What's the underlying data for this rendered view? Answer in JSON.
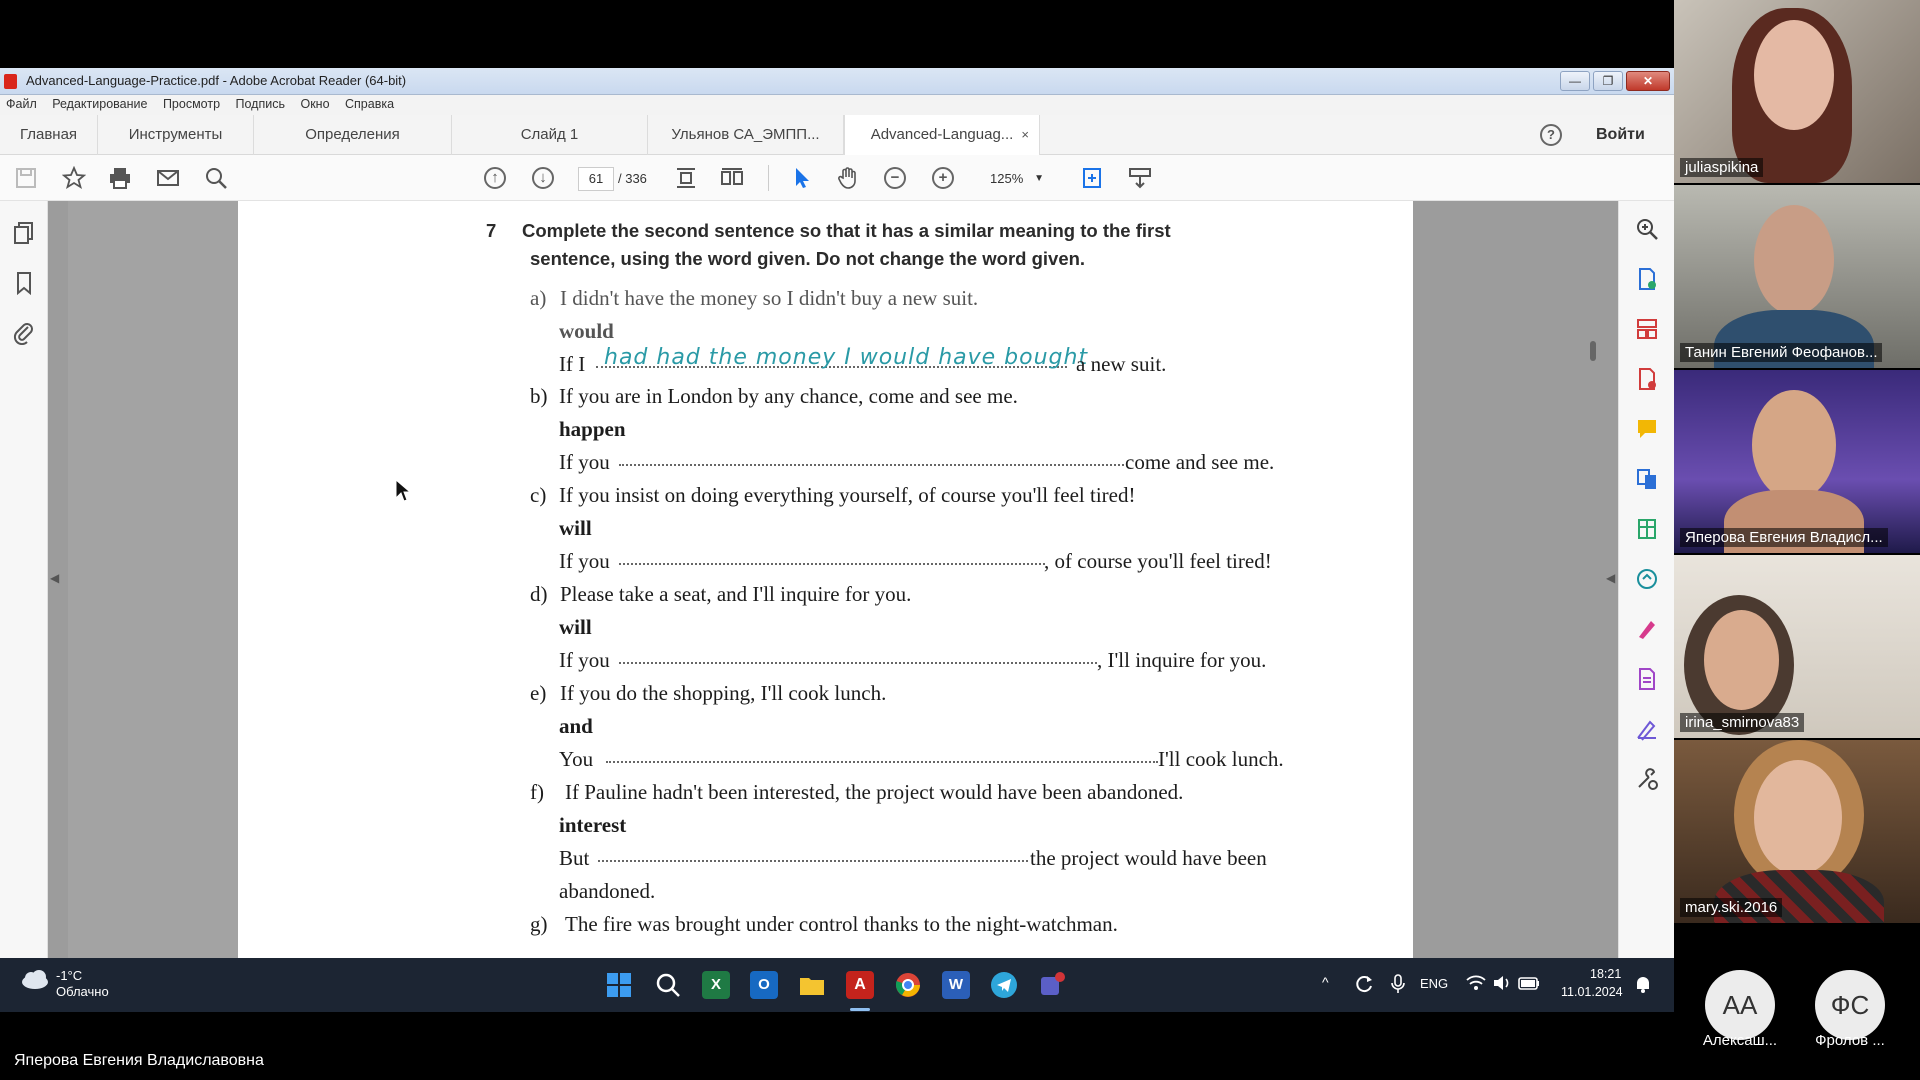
{
  "window": {
    "title": "Advanced-Language-Practice.pdf - Adobe Acrobat Reader (64-bit)",
    "minimize": "—",
    "restore": "❐",
    "close": "✕"
  },
  "menu": [
    "Файл",
    "Редактирование",
    "Просмотр",
    "Подпись",
    "Окно",
    "Справка"
  ],
  "tabs": {
    "home": "Главная",
    "tools": "Инструменты",
    "doc1": "Определения",
    "doc2": "Слайд 1",
    "doc3": "Ульянов СА_ЭМПП...",
    "doc4": "Advanced-Languag...",
    "close_icon": "×",
    "help": "?",
    "signin": "Войти"
  },
  "toolbar": {
    "page_current": "61",
    "page_total": "/ 336",
    "zoom": "125%"
  },
  "document": {
    "exercise_number": "7",
    "instruction_line1": "Complete the second sentence so that it has a similar meaning to the first",
    "instruction_line2": "sentence, using the word given. Do not change the word given.",
    "items": {
      "a": {
        "label": "a)",
        "sentence": "I didn't have the money so I didn't buy a new suit.",
        "word": "would",
        "start": "If I",
        "end": "a new suit.",
        "handwritten": "had had the money I would have bought"
      },
      "b": {
        "label": "b)",
        "sentence": "If you are in London by any chance, come and see me.",
        "word": "happen",
        "start": "If you",
        "end": "come and see me."
      },
      "c": {
        "label": "c)",
        "sentence": "If you insist on doing everything yourself, of course you'll feel tired!",
        "word": "will",
        "start": "If you",
        "end": ", of course you'll feel tired!"
      },
      "d": {
        "label": "d)",
        "sentence": "Please take a seat, and I'll inquire for you.",
        "word": "will",
        "start": "If you",
        "end": ", I'll inquire for you."
      },
      "e": {
        "label": "e)",
        "sentence": "If you do the shopping, I'll cook lunch.",
        "word": "and",
        "start": "You",
        "end": "I'll cook lunch."
      },
      "f": {
        "label": "f)",
        "sentence": "If Pauline hadn't been interested, the project would have been abandoned.",
        "word": "interest",
        "start": "But",
        "end": "the project would have been",
        "end2": "abandoned."
      },
      "g": {
        "label": "g)",
        "sentence": "The fire was brought under control thanks to the night-watchman."
      }
    }
  },
  "taskbar": {
    "weather_temp": "-1°C",
    "weather_desc": "Облачно",
    "lang": "ENG",
    "time": "18:21",
    "date": "11.01.2024"
  },
  "participants": [
    {
      "name": "juliaspikina"
    },
    {
      "name": "Танин Евгений Феофанов..."
    },
    {
      "name": "Яперова Евгения Владисл..."
    },
    {
      "name": "irina_smirnova83"
    },
    {
      "name": "mary.ski.2016"
    }
  ],
  "avatars": [
    {
      "initials": "АА",
      "name": "Алексаш...",
      "color": "#ececec"
    },
    {
      "initials": "ФС",
      "name": "Фролов ...",
      "color": "#ececec"
    }
  ],
  "active_speaker": "Яперова Евгения Владиславовна"
}
